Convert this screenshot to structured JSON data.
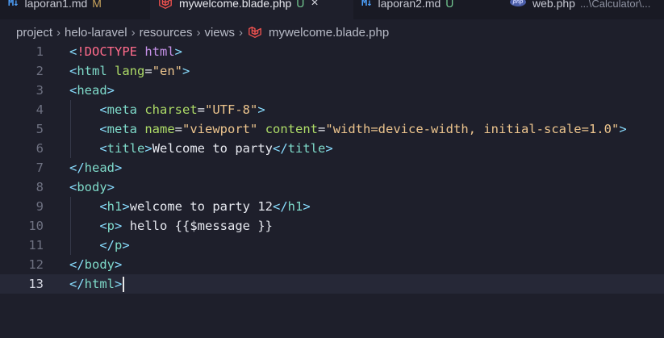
{
  "tabs": [
    {
      "label": "laporan1.md",
      "status": "M",
      "icon": "markdown-icon",
      "active": false
    },
    {
      "label": "mywelcome.blade.php",
      "status": "U",
      "icon": "laravel-icon",
      "active": true
    },
    {
      "label": "laporan2.md",
      "status": "U",
      "icon": "markdown-icon",
      "active": false
    },
    {
      "label": "web.php",
      "hint": "...\\Calculator\\...",
      "icon": "php-icon",
      "active": false
    }
  ],
  "tab_close_glyph": "×",
  "breadcrumb": {
    "items": [
      "project",
      "helo-laravel",
      "resources",
      "views",
      "mywelcome.blade.php"
    ],
    "separator": "›"
  },
  "editor": {
    "current_line": 13,
    "lines": [
      {
        "n": "1",
        "text": "<!DOCTYPE html>"
      },
      {
        "n": "2",
        "text": "<html lang=\"en\">"
      },
      {
        "n": "3",
        "text": "<head>"
      },
      {
        "n": "4",
        "text": "    <meta charset=\"UTF-8\">"
      },
      {
        "n": "5",
        "text": "    <meta name=\"viewport\" content=\"width=device-width, initial-scale=1.0\">"
      },
      {
        "n": "6",
        "text": "    <title>Welcome to party</title>"
      },
      {
        "n": "7",
        "text": "</head>"
      },
      {
        "n": "8",
        "text": "<body>"
      },
      {
        "n": "9",
        "text": "    <h1>welcome to party 12</h1>"
      },
      {
        "n": "10",
        "text": "    <p> hello {{$message }}"
      },
      {
        "n": "11",
        "text": "    </p>"
      },
      {
        "n": "12",
        "text": "</body>"
      },
      {
        "n": "13",
        "text": "</html>"
      }
    ]
  },
  "colors": {
    "background": "#1e1f2b",
    "tabbar": "#191a24",
    "current_line": "#262837",
    "punctuation": "#89ddff",
    "tag": "#7fdbca",
    "attribute": "#addb67",
    "string": "#ecc48d"
  }
}
